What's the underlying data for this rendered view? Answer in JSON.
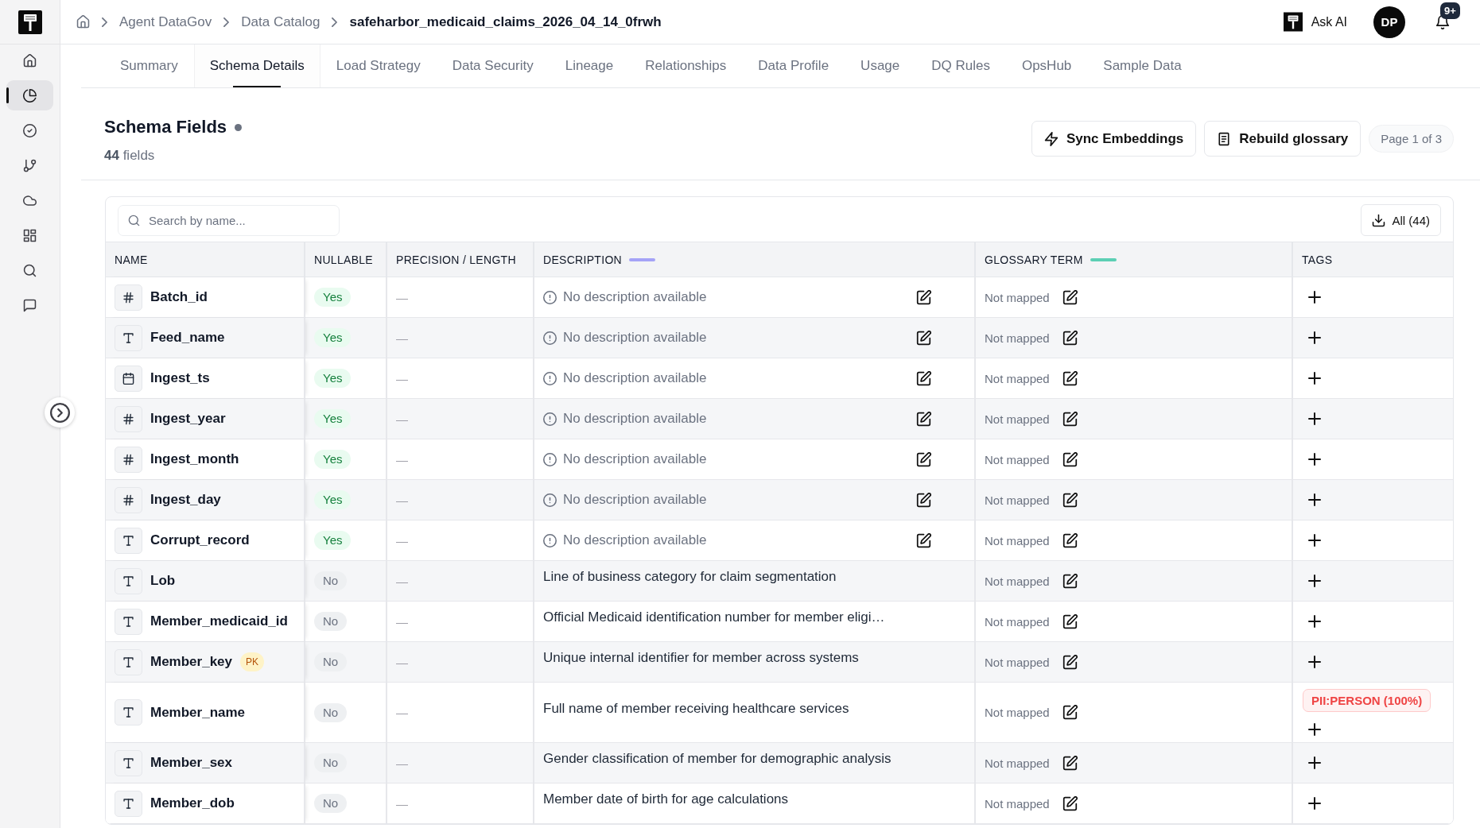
{
  "sidebar": {
    "items": [
      {
        "selected": false
      },
      {
        "selected": true
      },
      {
        "selected": false
      },
      {
        "selected": false
      },
      {
        "selected": false
      },
      {
        "selected": false
      },
      {
        "selected": false
      },
      {
        "selected": false
      }
    ]
  },
  "header": {
    "breadcrumb": [
      "Agent DataGov",
      "Data Catalog",
      "safeharbor_medicaid_claims_2026_04_14_0frwh"
    ],
    "ask_ai": "Ask AI",
    "avatar": "DP",
    "notifications": "9+"
  },
  "tabs": [
    {
      "label": "Summary",
      "selected": false
    },
    {
      "label": "Schema Details",
      "selected": true
    },
    {
      "label": "Load Strategy",
      "selected": false
    },
    {
      "label": "Data Security",
      "selected": false
    },
    {
      "label": "Lineage",
      "selected": false
    },
    {
      "label": "Relationships",
      "selected": false
    },
    {
      "label": "Data Profile",
      "selected": false
    },
    {
      "label": "Usage",
      "selected": false
    },
    {
      "label": "DQ Rules",
      "selected": false
    },
    {
      "label": "OpsHub",
      "selected": false
    },
    {
      "label": "Sample Data",
      "selected": false
    }
  ],
  "section": {
    "title": "Schema Fields",
    "count": "**44** fields",
    "actions": [
      "Sync Embeddings",
      "Rebuild glossary"
    ],
    "page": "Page 1 of 3"
  },
  "table": {
    "search": {
      "placeholder": "Search by name..."
    },
    "export": "All (44)",
    "columns": [
      {
        "label": "NAME"
      },
      {
        "label": "NULLABLE"
      },
      {
        "label": "PRECISION / LENGTH"
      },
      {
        "label": "DESCRIPTION",
        "color": "#a5a3f7"
      },
      {
        "label": "GLOSSARY TERM",
        "color": "#5ccfb4"
      },
      {
        "label": "TAGS"
      }
    ],
    "rows": [
      {
        "name": "Batch_id",
        "kind": "number",
        "nullable": {
          "label": "Yes",
          "on": true
        },
        "precision": "—",
        "description": {
          "text": "No description available",
          "missing": true
        },
        "glossary": "Not mapped"
      },
      {
        "name": "Feed_name",
        "kind": "text",
        "nullable": {
          "label": "Yes",
          "on": true
        },
        "precision": "—",
        "description": {
          "text": "No description available",
          "missing": true
        },
        "glossary": "Not mapped"
      },
      {
        "name": "Ingest_ts",
        "kind": "date",
        "nullable": {
          "label": "Yes",
          "on": true
        },
        "precision": "—",
        "description": {
          "text": "No description available",
          "missing": true
        },
        "glossary": "Not mapped"
      },
      {
        "name": "Ingest_year",
        "kind": "number",
        "nullable": {
          "label": "Yes",
          "on": true
        },
        "precision": "—",
        "description": {
          "text": "No description available",
          "missing": true
        },
        "glossary": "Not mapped"
      },
      {
        "name": "Ingest_month",
        "kind": "number",
        "nullable": {
          "label": "Yes",
          "on": true
        },
        "precision": "—",
        "description": {
          "text": "No description available",
          "missing": true
        },
        "glossary": "Not mapped"
      },
      {
        "name": "Ingest_day",
        "kind": "number",
        "nullable": {
          "label": "Yes",
          "on": true
        },
        "precision": "—",
        "description": {
          "text": "No description available",
          "missing": true
        },
        "glossary": "Not mapped"
      },
      {
        "name": "Corrupt_record",
        "kind": "text",
        "nullable": {
          "label": "Yes",
          "on": true
        },
        "precision": "—",
        "description": {
          "text": "No description available",
          "missing": true
        },
        "glossary": "Not mapped"
      },
      {
        "name": "Lob",
        "kind": "text",
        "nullable": {
          "label": "No",
          "on": false
        },
        "precision": "—",
        "description": {
          "text": "Line of business category for claim segmentation",
          "missing": false
        },
        "glossary": "Not mapped"
      },
      {
        "name": "Member_medicaid_id",
        "kind": "text",
        "nullable": {
          "label": "No",
          "on": false
        },
        "precision": "—",
        "description": {
          "text": "Official Medicaid identification number for member eligi…",
          "missing": false
        },
        "glossary": "Not mapped"
      },
      {
        "name": "Member_key",
        "kind": "text",
        "badge": "PK",
        "nullable": {
          "label": "No",
          "on": false
        },
        "precision": "—",
        "description": {
          "text": "Unique internal identifier for member across systems",
          "missing": false
        },
        "glossary": "Not mapped"
      },
      {
        "name": "Member_name",
        "kind": "text",
        "nullable": {
          "label": "No",
          "on": false
        },
        "precision": "—",
        "description": {
          "text": "Full name of member receiving healthcare services",
          "missing": false
        },
        "glossary": "Not mapped",
        "tags": [
          {
            "label": "PII:PERSON (100%)"
          }
        ]
      },
      {
        "name": "Member_sex",
        "kind": "text",
        "nullable": {
          "label": "No",
          "on": false
        },
        "precision": "—",
        "description": {
          "text": "Gender classification of member for demographic analysis",
          "missing": false
        },
        "glossary": "Not mapped"
      },
      {
        "name": "Member_dob",
        "kind": "text",
        "nullable": {
          "label": "No",
          "on": false
        },
        "precision": "—",
        "description": {
          "text": "Member date of birth for age calculations",
          "missing": false
        },
        "glossary": "Not mapped"
      }
    ]
  }
}
